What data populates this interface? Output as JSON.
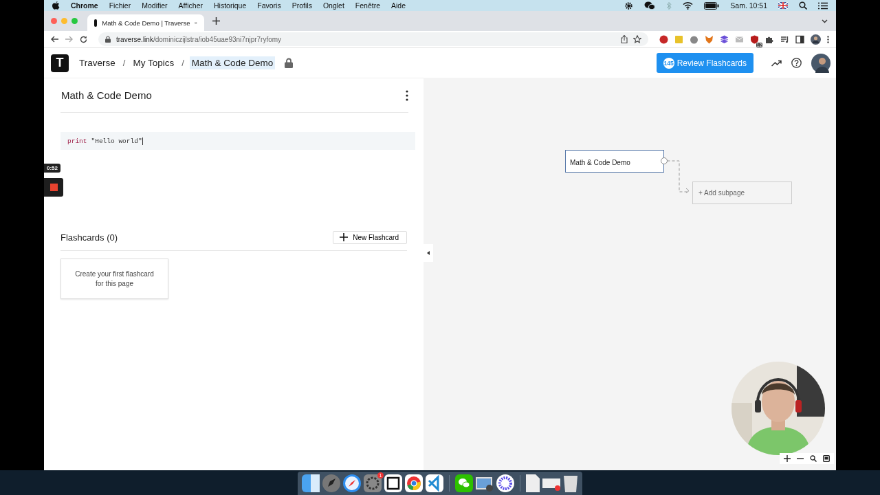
{
  "menu_bar": {
    "app": "Chrome",
    "items": [
      "Fichier",
      "Modifier",
      "Afficher",
      "Historique",
      "Favoris",
      "Profils",
      "Onglet",
      "Fenêtre",
      "Aide"
    ],
    "clock": "Sam. 10:51"
  },
  "tabs": [
    {
      "title": "Math & Code Demo | Traverse",
      "selected": true
    }
  ],
  "address": {
    "host": "traverse.link",
    "path": "/dominiczijlstra/iob45uae93ni7njpr7ryfomy"
  },
  "extension_badge": "12",
  "header": {
    "logo": "T",
    "separator": "/",
    "breadcrumbs": [
      {
        "label": "Traverse",
        "selected": false
      },
      {
        "label": "My Topics",
        "selected": false
      },
      {
        "label": "Math & Code Demo",
        "selected": true
      }
    ],
    "review_count": "145",
    "review_label": "Review Flashcards"
  },
  "page": {
    "title": "Math & Code Demo",
    "code": {
      "keyword": "print",
      "string": "\"Hello world\""
    },
    "recorder_time": "0:52",
    "flashcards_title": "Flashcards (0)",
    "new_flashcard": "New Flashcard",
    "empty_card": "Create your first flashcard for this page"
  },
  "canvas": {
    "node": "Math & Code Demo",
    "add_subpage": "+ Add subpage"
  },
  "dock": {
    "badge": "1"
  }
}
